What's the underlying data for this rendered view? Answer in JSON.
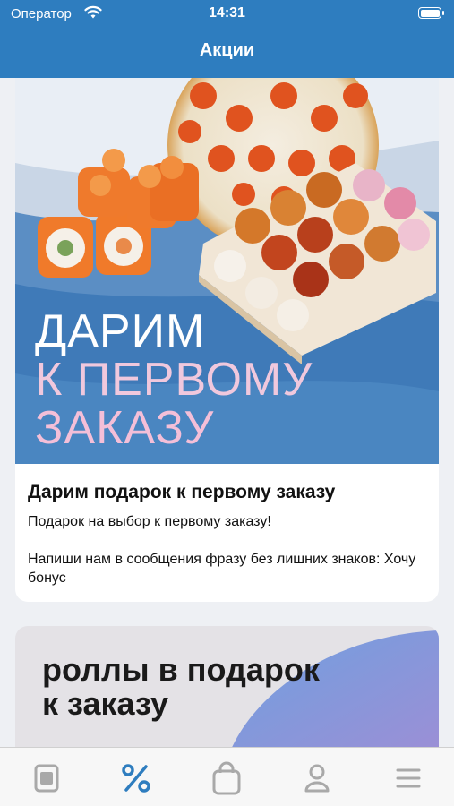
{
  "status_bar": {
    "carrier": "Оператор",
    "time": "14:31"
  },
  "header": {
    "title": "Акции"
  },
  "promos": [
    {
      "banner": {
        "line1": "ДАРИМ",
        "line2": "К ПЕРВОМУ",
        "line3": "ЗАКАЗУ"
      },
      "title": "Дарим подарок к первому заказу",
      "description_1": "Подарок на выбор к первому заказу!",
      "description_2": "Напиши нам в сообщения фразу без лишних знаков: Хочу бонус"
    },
    {
      "banner": {
        "line1": "роллы в подарок",
        "line2": "к заказу"
      }
    }
  ],
  "tabbar": {
    "items": [
      {
        "icon": "menu-book-icon",
        "active": false
      },
      {
        "icon": "percent-icon",
        "active": true
      },
      {
        "icon": "bag-icon",
        "active": false
      },
      {
        "icon": "profile-icon",
        "active": false
      },
      {
        "icon": "hamburger-icon",
        "active": false
      }
    ]
  },
  "colors": {
    "accent": "#2e7dbf",
    "inactive_icon": "#a9a9a9"
  }
}
